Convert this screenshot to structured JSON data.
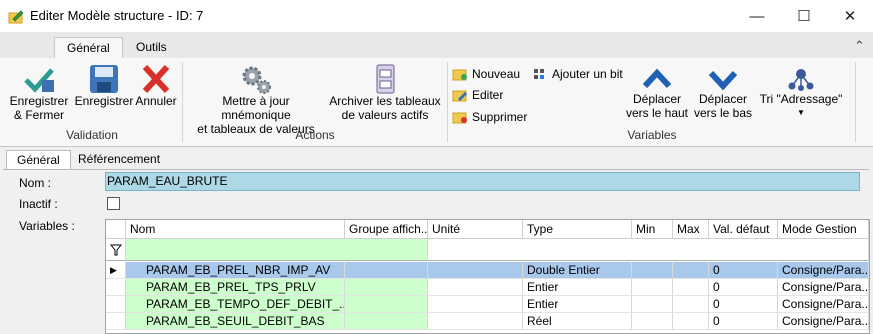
{
  "window": {
    "title": "Editer Modèle structure - ID: 7",
    "minimize": "—",
    "maximize": "☐",
    "close": "✕"
  },
  "ribbon": {
    "tabs": [
      "Général",
      "Outils"
    ],
    "collapse_glyph": "⌃",
    "validation": {
      "group": "Validation",
      "save_close": [
        "Enregistrer",
        "& Fermer"
      ],
      "save": "Enregistrer",
      "cancel": "Annuler"
    },
    "actions": {
      "group": "Actions",
      "update_mnemonic": [
        "Mettre à jour mnémonique",
        "et tableaux de valeurs"
      ],
      "archive": [
        "Archiver les tableaux",
        "de valeurs actifs"
      ]
    },
    "variables": {
      "group": "Variables",
      "new": "Nouveau",
      "add_bit": "Ajouter un bit",
      "edit": "Editer",
      "delete": "Supprimer",
      "move_up": [
        "Déplacer",
        "vers le haut"
      ],
      "move_down": [
        "Déplacer",
        "vers le bas"
      ],
      "sort": "Tri \"Adressage\""
    }
  },
  "content_tabs": [
    "Général",
    "Référencement"
  ],
  "form": {
    "nom_label": "Nom :",
    "nom_value": "PARAM_EAU_BRUTE",
    "inactif_label": "Inactif :",
    "variables_label": "Variables :"
  },
  "grid": {
    "headers": [
      "Nom",
      "Groupe affich...",
      "Unité",
      "Type",
      "Min",
      "Max",
      "Val. défaut",
      "Mode Gestion"
    ],
    "rows": [
      [
        "PARAM_EB_PREL_NBR_IMP_AV",
        "",
        "",
        "Double Entier",
        "",
        "",
        "0",
        "Consigne/Para..."
      ],
      [
        "PARAM_EB_PREL_TPS_PRLV",
        "",
        "",
        "Entier",
        "",
        "",
        "0",
        "Consigne/Para..."
      ],
      [
        "PARAM_EB_TEMPO_DEF_DEBIT_...",
        "",
        "",
        "Entier",
        "",
        "",
        "0",
        "Consigne/Para..."
      ],
      [
        "PARAM_EB_SEUIL_DEBIT_BAS",
        "",
        "",
        "Réel",
        "",
        "",
        "0",
        "Consigne/Para..."
      ]
    ]
  },
  "colors": {
    "nom_field": "#add8e6",
    "green_cells": "#ccffcc",
    "selected_row": "#a8c8ec"
  }
}
